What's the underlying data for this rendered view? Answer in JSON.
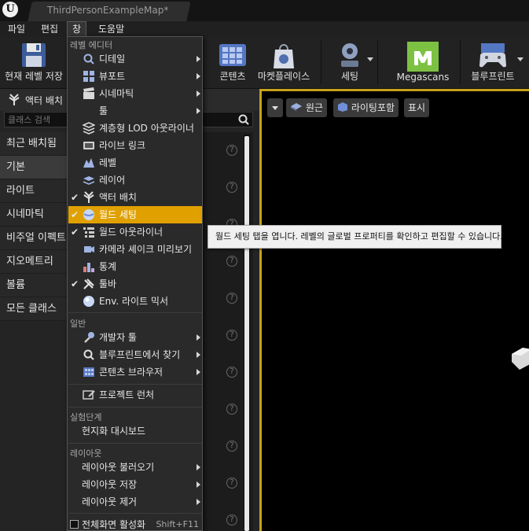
{
  "titlebar": {
    "document_tab": "ThirdPersonExampleMap*"
  },
  "menubar": {
    "file": "파일",
    "edit": "편집",
    "window": "창",
    "help": "도움말"
  },
  "toolbar": {
    "save_current_level": "현재 레벨 저장",
    "content": "콘텐츠",
    "marketplace": "마켓플레이스",
    "settings": "세팅",
    "megascans": "Megascans",
    "blueprints": "블루프린트"
  },
  "left_panel": {
    "tab_label": "액터 배치",
    "search_placeholder": "클래스 검색",
    "categories": [
      "최근 배치됨",
      "기본",
      "라이트",
      "시네마틱",
      "비주얼 이펙트",
      "지오메트리",
      "볼륨",
      "모든 클래스"
    ],
    "active_category_index": 1
  },
  "viewport": {
    "perspective": "원근",
    "lit": "라이팅포함",
    "show": "표시"
  },
  "window_menu": {
    "section_level_editor": "레벨 에디터",
    "items_level_editor": [
      {
        "label": "디테일",
        "icon": "details-icon",
        "checked": false,
        "submenu": true
      },
      {
        "label": "뷰포트",
        "icon": "viewport-icon",
        "checked": false,
        "submenu": true
      },
      {
        "label": "시네마틱",
        "icon": "cinematic-icon",
        "checked": false,
        "submenu": true
      },
      {
        "label": "툴",
        "icon": "tools-icon",
        "checked": false,
        "submenu": true
      },
      {
        "label": "계층형 LOD 아웃라이너",
        "icon": "hlod-icon",
        "checked": false,
        "submenu": false
      },
      {
        "label": "라이브 링크",
        "icon": "live-link-icon",
        "checked": false,
        "submenu": false
      },
      {
        "label": "레벨",
        "icon": "levels-icon",
        "checked": false,
        "submenu": false
      },
      {
        "label": "레이어",
        "icon": "layers-icon",
        "checked": false,
        "submenu": false
      },
      {
        "label": "액터 배치",
        "icon": "place-actors-icon",
        "checked": true,
        "submenu": false
      },
      {
        "label": "월드 세팅",
        "icon": "world-settings-icon",
        "checked": true,
        "submenu": false,
        "highlighted": true
      },
      {
        "label": "월드 아웃라이너",
        "icon": "world-outliner-icon",
        "checked": true,
        "submenu": false
      },
      {
        "label": "카메라 셰이크 미리보기",
        "icon": "camera-shake-icon",
        "checked": false,
        "submenu": false
      },
      {
        "label": "통계",
        "icon": "statistics-icon",
        "checked": false,
        "submenu": false
      },
      {
        "label": "툴바",
        "icon": "toolbar-icon",
        "checked": true,
        "submenu": false
      },
      {
        "label": "Env. 라이트 믹서",
        "icon": "env-light-mixer-icon",
        "checked": false,
        "submenu": false
      }
    ],
    "section_general": "일반",
    "items_general": [
      {
        "label": "개발자 툴",
        "icon": "developer-tools-icon",
        "submenu": true
      },
      {
        "label": "블루프린트에서 찾기",
        "icon": "find-in-blueprints-icon",
        "submenu": true
      },
      {
        "label": "콘텐츠 브라우저",
        "icon": "content-browser-icon",
        "submenu": true
      }
    ],
    "project_launcher": "프로젝트 런처",
    "section_experimental": "실험단계",
    "localization_dashboard": "현지화 대시보드",
    "section_layout": "레이아웃",
    "load_layout": "레이아웃 불러오기",
    "save_layout": "레이아웃 저장",
    "remove_layout": "레이아웃 제거",
    "enable_fullscreen": "전체화면 활성화",
    "fullscreen_shortcut": "Shift+F11"
  },
  "tooltip": {
    "text": "월드 세팅 탭을 엽니다. 레벨의 글로벌 프로퍼티를 확인하고 편집할 수 있습니다."
  },
  "colors": {
    "highlight": "#e0a100",
    "viewport_border": "#c8a11a",
    "megascans": "#7dc142"
  }
}
